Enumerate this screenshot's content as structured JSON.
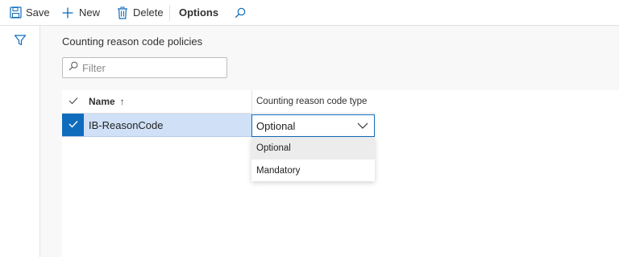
{
  "toolbar": {
    "save_label": "Save",
    "new_label": "New",
    "delete_label": "Delete",
    "options_label": "Options"
  },
  "page": {
    "title": "Counting reason code policies"
  },
  "filter": {
    "placeholder": "Filter"
  },
  "grid": {
    "columns": {
      "name": "Name",
      "name_sort_glyph": "↑",
      "type": "Counting reason code type"
    },
    "rows": [
      {
        "name": "IB-ReasonCode",
        "type": "Optional",
        "selected": true
      }
    ]
  },
  "dropdown": {
    "options": [
      "Optional",
      "Mandatory"
    ],
    "highlighted": "Optional"
  },
  "colors": {
    "accent": "#0f6cbd",
    "selected_row": "#cfe0f7",
    "icon": "#0f6cbd"
  },
  "icons": {
    "save": "save-icon",
    "new": "plus-icon",
    "delete": "trash-icon",
    "search": "search-icon",
    "filter": "funnel-icon",
    "check": "checkmark-icon",
    "chevron": "chevron-down-icon"
  }
}
